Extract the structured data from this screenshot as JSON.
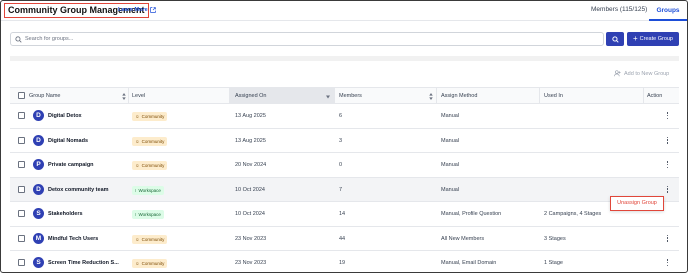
{
  "header": {
    "title": "Community Group Management",
    "learn_more": "Learn More",
    "tabs": [
      {
        "label": "Members (115/125)",
        "active": false
      },
      {
        "label": "Groups",
        "active": true
      }
    ]
  },
  "search": {
    "placeholder": "Search for groups...",
    "create_label": "Create Group"
  },
  "toolbar": {
    "add_to_new_group": "Add to New Group"
  },
  "table": {
    "columns": [
      "Group Name",
      "Level",
      "Assigned On",
      "Members",
      "Assign Method",
      "Used In",
      "Action"
    ],
    "rows": [
      {
        "initial": "D",
        "name": "Digital Detox",
        "level": "Community",
        "assigned_on": "13 Aug 2025",
        "members": "6",
        "method": "Manual",
        "used_in": ""
      },
      {
        "initial": "D",
        "name": "Digital Nomads",
        "level": "Community",
        "assigned_on": "13 Aug 2025",
        "members": "3",
        "method": "Manual",
        "used_in": ""
      },
      {
        "initial": "P",
        "name": "Private campaign",
        "level": "Community",
        "assigned_on": "20 Nov 2024",
        "members": "0",
        "method": "Manual",
        "used_in": ""
      },
      {
        "initial": "D",
        "name": "Detox community team",
        "level": "Workspace",
        "assigned_on": "10 Oct 2024",
        "members": "7",
        "method": "Manual",
        "used_in": ""
      },
      {
        "initial": "S",
        "name": "Stakeholders",
        "level": "Workspace",
        "assigned_on": "10 Oct 2024",
        "members": "14",
        "method": "Manual, Profile Question",
        "used_in": "2 Campaigns, 4 Stages"
      },
      {
        "initial": "M",
        "name": "Mindful Tech Users",
        "level": "Community",
        "assigned_on": "23 Nov 2023",
        "members": "44",
        "method": "All New Members",
        "used_in": "3 Stages"
      },
      {
        "initial": "S",
        "name": "Screen Time Reduction S...",
        "level": "Community",
        "assigned_on": "23 Nov 2023",
        "members": "19",
        "method": "Manual, Email Domain",
        "used_in": "1 Stage"
      }
    ]
  },
  "popover": {
    "label": "Unassign Group"
  },
  "colors": {
    "accent": "#2f40b3",
    "highlight_red": "#e0463a",
    "community_badge_bg": "#fdeccc",
    "workspace_badge_bg": "#dcfce7"
  }
}
